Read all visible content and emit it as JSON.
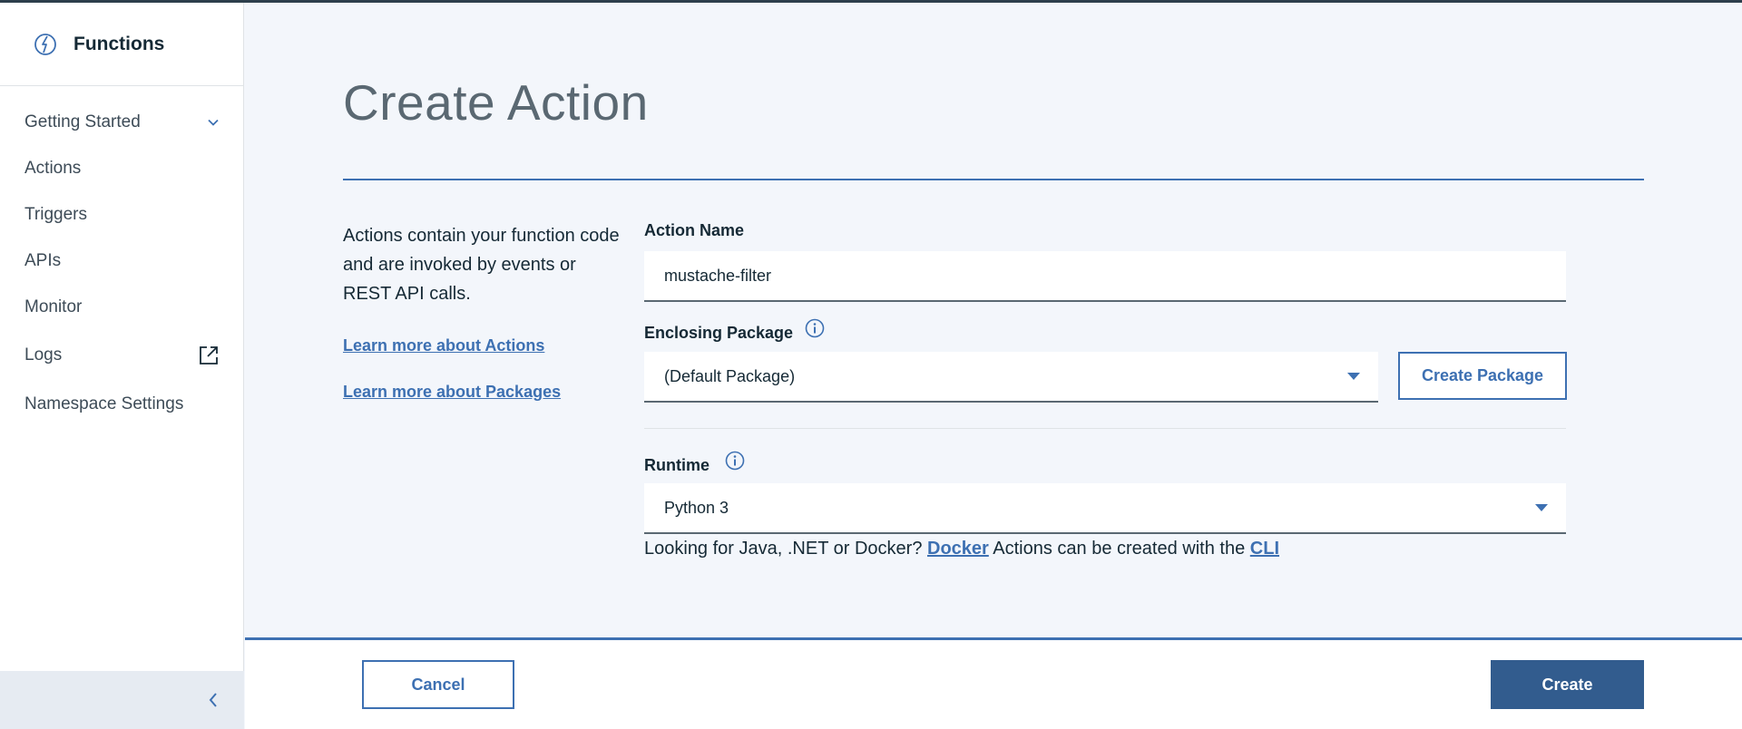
{
  "app": {
    "title": "Functions",
    "icon": "functions-logo-icon"
  },
  "sidebar": {
    "items": [
      {
        "label": "Getting Started",
        "icon": "chevron-down-icon"
      },
      {
        "label": "Actions"
      },
      {
        "label": "Triggers"
      },
      {
        "label": "APIs"
      },
      {
        "label": "Monitor"
      },
      {
        "label": "Logs",
        "icon": "external-link-icon"
      },
      {
        "label": "Namespace Settings"
      }
    ],
    "collapse_icon": "chevron-left-icon"
  },
  "page": {
    "title": "Create Action",
    "description": "Actions contain your function code and are invoked by events or REST API calls.",
    "links": {
      "actions": "Learn more about Actions",
      "packages": "Learn more about Packages"
    }
  },
  "form": {
    "action_name": {
      "label": "Action Name",
      "value": "mustache-filter"
    },
    "enclosing_package": {
      "label": "Enclosing Package",
      "selected": "(Default Package)",
      "create_button": "Create Package"
    },
    "runtime": {
      "label": "Runtime",
      "selected": "Python 3"
    },
    "hint": {
      "prefix": "Looking for Java, .NET or Docker?",
      "docker_link": "Docker",
      "middle": "Actions can be created with the",
      "cli_link": "CLI"
    }
  },
  "footer": {
    "cancel_label": "Cancel",
    "create_label": "Create"
  },
  "colors": {
    "accent": "#3d70b2",
    "primary_button": "#325c8e",
    "background": "#f3f6fb"
  }
}
